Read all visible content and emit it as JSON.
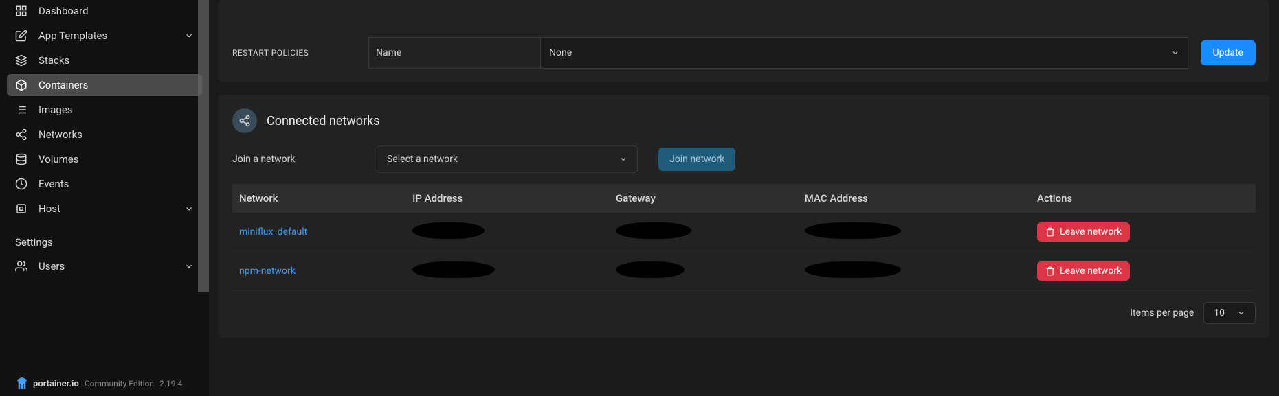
{
  "sidebar": {
    "nav": [
      {
        "label": "Dashboard"
      },
      {
        "label": "App Templates"
      },
      {
        "label": "Stacks"
      },
      {
        "label": "Containers"
      },
      {
        "label": "Images"
      },
      {
        "label": "Networks"
      },
      {
        "label": "Volumes"
      },
      {
        "label": "Events"
      },
      {
        "label": "Host"
      }
    ],
    "settingsHeader": "Settings",
    "users": "Users",
    "footer": {
      "brand": "portainer.io",
      "edition": "Community Edition",
      "version": "2.19.4"
    }
  },
  "restart": {
    "label": "RESTART POLICIES",
    "nameHeader": "Name",
    "selectValue": "None",
    "updateBtn": "Update"
  },
  "networks": {
    "title": "Connected networks",
    "joinLabel": "Join a network",
    "selectPlaceholder": "Select a network",
    "joinBtn": "Join network",
    "columns": {
      "network": "Network",
      "ip": "IP Address",
      "gateway": "Gateway",
      "mac": "MAC Address",
      "actions": "Actions"
    },
    "rows": [
      {
        "name": "miniflux_default",
        "leave": "Leave network"
      },
      {
        "name": "npm-network",
        "leave": "Leave network"
      }
    ],
    "pagination": {
      "label": "Items per page",
      "value": "10"
    }
  }
}
